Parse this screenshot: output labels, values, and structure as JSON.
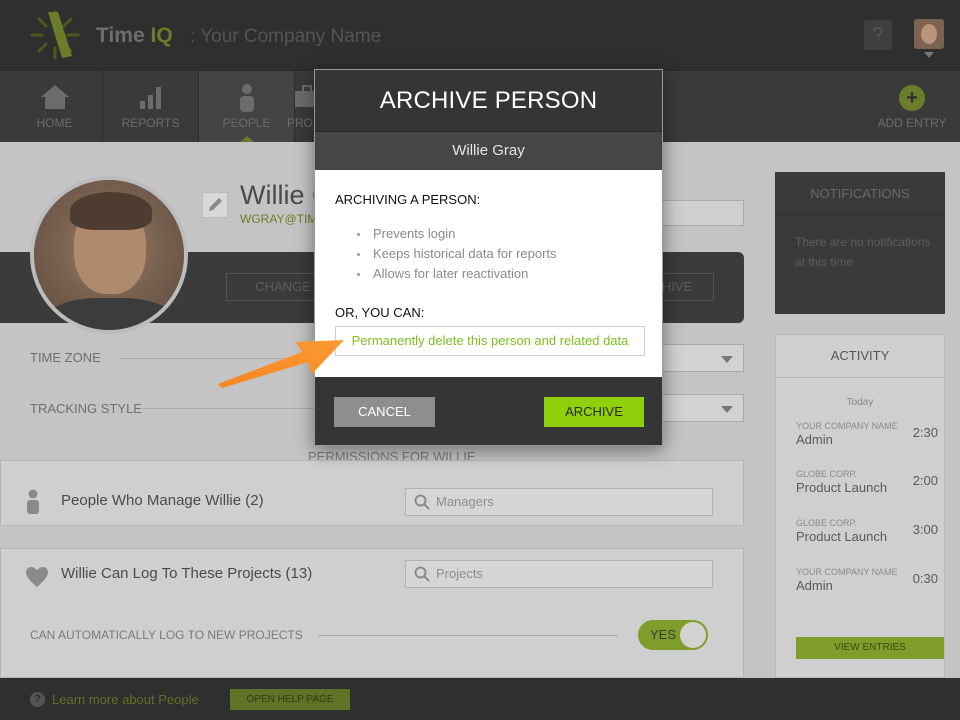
{
  "header": {
    "brand_time": "Time",
    "brand_iq": "IQ",
    "company": ": Your Company Name",
    "help_label": "?"
  },
  "nav": {
    "items": [
      {
        "label": "HOME",
        "icon": "home-icon"
      },
      {
        "label": "REPORTS",
        "icon": "bar-chart-icon"
      },
      {
        "label": "PEOPLE",
        "icon": "person-icon"
      },
      {
        "label": "PRO",
        "icon": "briefcase-icon"
      }
    ],
    "add_entry": "ADD ENTRY"
  },
  "profile": {
    "name": "Willie G",
    "email": "WGRAY@TIM",
    "change_label": "CHANGE",
    "archive_label": "HIVE"
  },
  "fields": {
    "time_zone": "TIME ZONE",
    "tracking_style": "TRACKING STYLE"
  },
  "permissions": {
    "heading": "PERMISSIONS FOR WILLIE",
    "managers_label": "People Who Manage Willie (2)",
    "managers_placeholder": "Managers",
    "projects_label": "Willie Can Log To These Projects (13)",
    "projects_placeholder": "Projects",
    "auto_log_label": "CAN AUTOMATICALLY LOG TO NEW PROJECTS",
    "auto_log_value": "YES"
  },
  "notifications": {
    "title": "NOTIFICATIONS",
    "empty_text": "There are no notifications at this time"
  },
  "activity": {
    "title": "ACTIVITY",
    "day": "Today",
    "items": [
      {
        "org": "YOUR COMPANY NAME",
        "project": "Admin",
        "duration": "2:30"
      },
      {
        "org": "GLOBE CORP.",
        "project": "Product Launch",
        "duration": "2:00"
      },
      {
        "org": "GLOBE CORP.",
        "project": "Product Launch",
        "duration": "3:00"
      },
      {
        "org": "YOUR COMPANY NAME",
        "project": "Admin",
        "duration": "0:30"
      }
    ],
    "view_entries": "VIEW ENTRIES"
  },
  "footer": {
    "learn_more": "Learn more about People",
    "open_help": "OPEN HELP PAGE"
  },
  "modal": {
    "title": "ARCHIVE PERSON",
    "person": "Willie Gray",
    "archiving_heading": "ARCHIVING A PERSON:",
    "bullets": [
      "Prevents login",
      "Keeps historical data for reports",
      "Allows for later reactivation"
    ],
    "or_heading": "OR, YOU CAN:",
    "delete_link": "Permanently delete this person and related data",
    "cancel": "CANCEL",
    "archive": "ARCHIVE"
  },
  "colors": {
    "accent_green": "#8fcf0c",
    "link_green": "#7fbd1f",
    "arrow_orange": "#f7851e",
    "dark_bar": "#353535"
  }
}
